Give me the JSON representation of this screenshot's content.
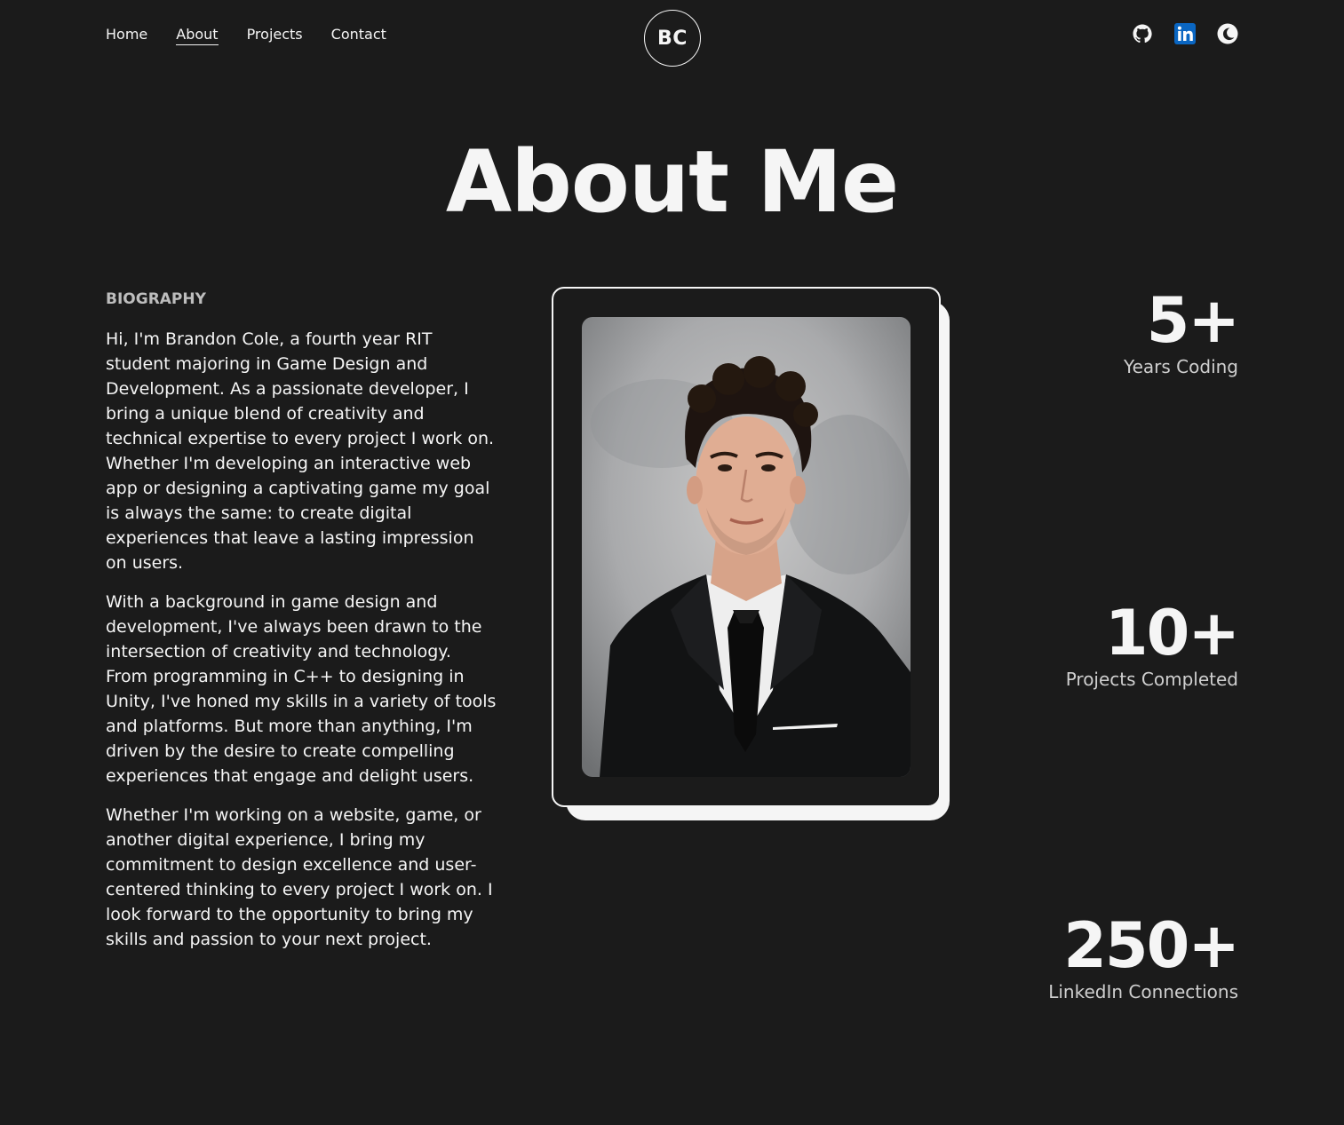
{
  "nav": {
    "items": [
      {
        "label": "Home"
      },
      {
        "label": "About"
      },
      {
        "label": "Projects"
      },
      {
        "label": "Contact"
      }
    ]
  },
  "logo": {
    "initials": "BC"
  },
  "social": {
    "icons": [
      "github-icon",
      "linkedin-icon",
      "theme-toggle-icon"
    ],
    "linkedin_color": "#0a66c2"
  },
  "hero": {
    "title": "About Me"
  },
  "bio": {
    "heading": "BIOGRAPHY",
    "paragraphs": [
      "Hi, I'm Brandon Cole, a fourth year RIT student majoring in Game Design and Development. As a passionate developer, I bring a unique blend of creativity and technical expertise to every project I work on. Whether I'm developing an interactive web app or designing a captivating game my goal is always the same: to create digital experiences that leave a lasting impression on users.",
      "With a background in game design and development, I've always been drawn to the intersection of creativity and technology. From programming in C++ to designing in Unity, I've honed my skills in a variety of tools and platforms. But more than anything, I'm driven by the desire to create compelling experiences that engage and delight users.",
      "Whether I'm working on a website, game, or another digital experience, I bring my commitment to design excellence and user-centered thinking to every project I work on. I look forward to the opportunity to bring my skills and passion to your next project."
    ]
  },
  "stats": [
    {
      "value": "5+",
      "label": "Years Coding"
    },
    {
      "value": "10+",
      "label": "Projects Completed"
    },
    {
      "value": "250+",
      "label": "LinkedIn Connections"
    }
  ],
  "colors": {
    "background": "#1b1b1b",
    "text": "#f5f5f5",
    "muted": "#bdbdbd"
  }
}
